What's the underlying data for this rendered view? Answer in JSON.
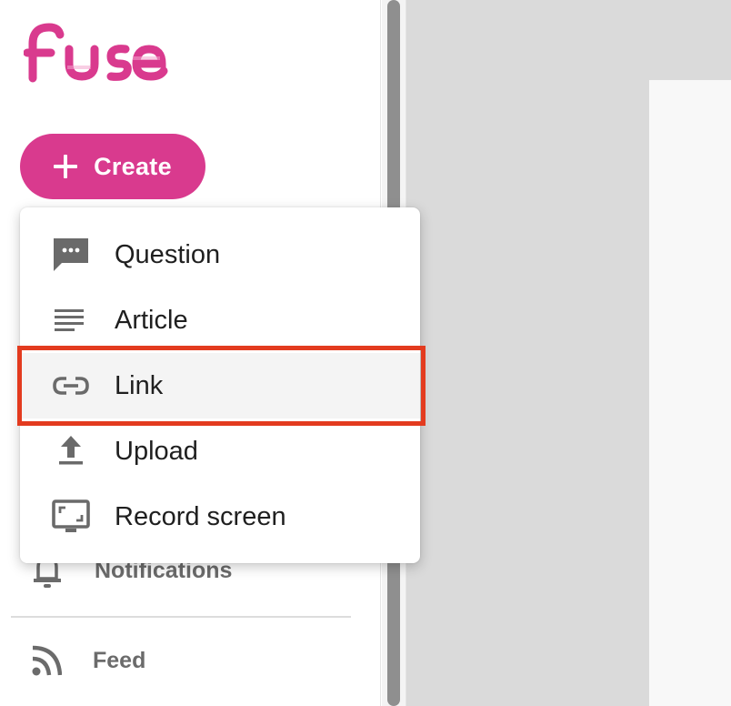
{
  "app": {
    "logo_text": "fuse",
    "brand_color": "#d93a8e"
  },
  "sidebar": {
    "create_button": {
      "label": "Create",
      "icon": "plus-icon"
    },
    "items": [
      {
        "label": "Notifications",
        "icon": "bell-icon"
      },
      {
        "label": "Feed",
        "icon": "rss-icon"
      }
    ]
  },
  "create_menu": {
    "items": [
      {
        "label": "Question",
        "icon": "chat-bubble-icon"
      },
      {
        "label": "Article",
        "icon": "lines-icon"
      },
      {
        "label": "Link",
        "icon": "link-icon",
        "selected": true
      },
      {
        "label": "Upload",
        "icon": "upload-icon"
      },
      {
        "label": "Record screen",
        "icon": "screen-record-icon"
      }
    ]
  },
  "annotation": {
    "highlight_color": "#e33b1f",
    "highlight_target": "Link"
  }
}
